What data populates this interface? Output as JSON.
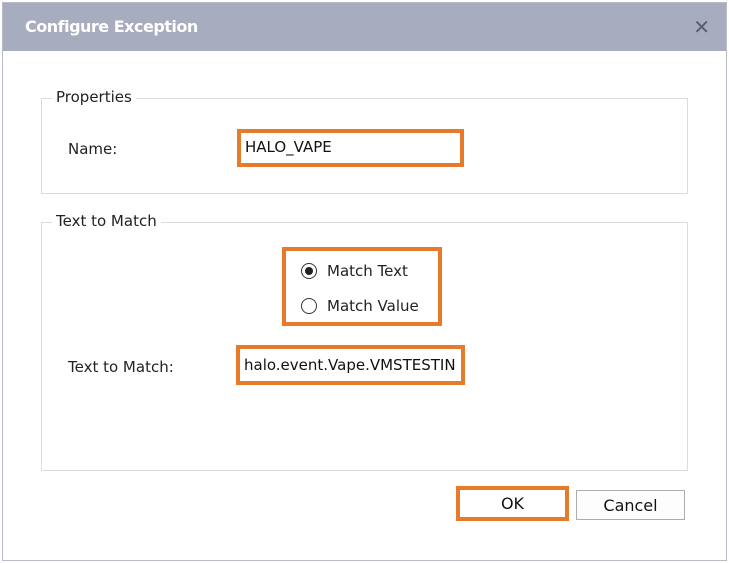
{
  "dialog": {
    "title": "Configure Exception",
    "close_icon": "close-icon"
  },
  "properties": {
    "legend": "Properties",
    "name_label": "Name:",
    "name_value": "HALO_VAPE"
  },
  "text_to_match": {
    "legend": "Text to Match",
    "options": [
      {
        "label": "Match Text",
        "selected": true
      },
      {
        "label": "Match Value",
        "selected": false
      }
    ],
    "field_label": "Text to Match:",
    "field_value": "halo.event.Vape.VMSTESTIN"
  },
  "buttons": {
    "ok": "OK",
    "cancel": "Cancel"
  },
  "colors": {
    "highlight": "#e87a2c",
    "titlebar": "#a7acbe"
  }
}
